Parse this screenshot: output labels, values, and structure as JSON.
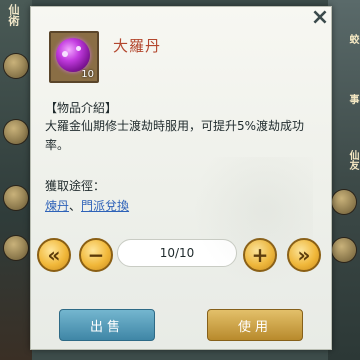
{
  "background": {
    "left_label": "仙術",
    "right_tags": [
      "蛟",
      "事",
      "仙友"
    ]
  },
  "item": {
    "name": "大羅丹",
    "count": "10",
    "icon": "purple-pill-icon"
  },
  "info": {
    "section_title": "【物品介紹】",
    "description": "大羅金仙期修士渡劫時服用，可提升5%渡劫成功率。",
    "source_title": "獲取途徑：",
    "sources": [
      "煉丹",
      "門派兌換"
    ],
    "source_sep": "、"
  },
  "quantity": {
    "value": "10/10",
    "min_label": "«",
    "dec_label": "−",
    "inc_label": "+",
    "max_label": "»"
  },
  "actions": {
    "sell_label": "出售",
    "use_label": "使用"
  },
  "close_label": "×",
  "colors": {
    "item_name": "#b3472e",
    "link": "#2e62b8",
    "sell_button": "#3f86a6",
    "use_button": "#b88a2c",
    "round_button": "#f1b83a"
  }
}
